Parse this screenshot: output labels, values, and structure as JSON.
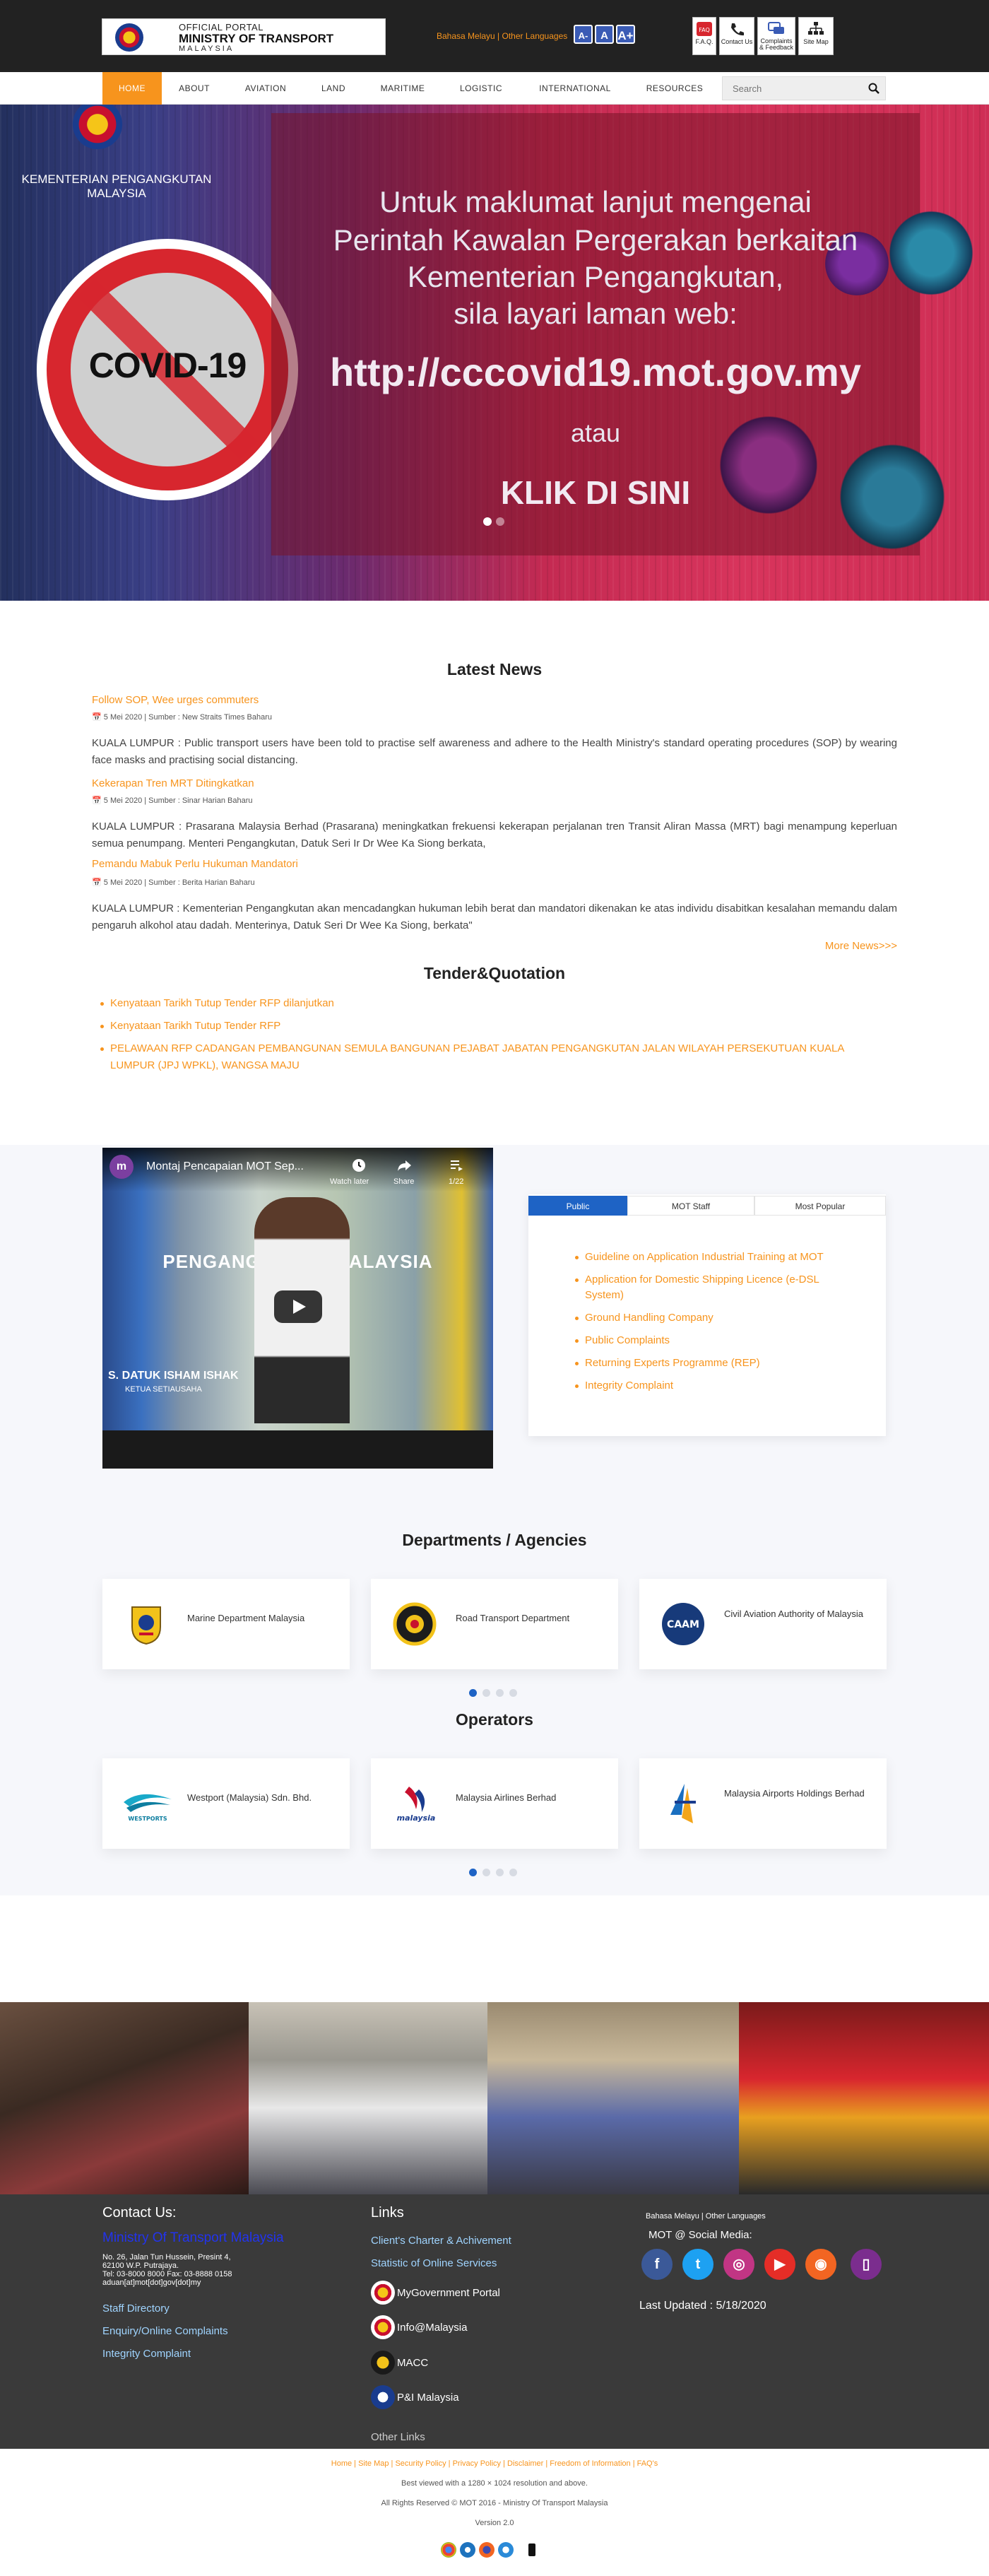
{
  "header": {
    "logo_line1": "OFFICIAL PORTAL",
    "logo_line2": "MINISTRY OF TRANSPORT",
    "logo_line3": "MALAYSIA",
    "lang_bm": "Bahasa Melayu",
    "lang_sep": " | ",
    "lang_other": "Other Languages",
    "font_buttons": [
      "A-",
      "A",
      "A+"
    ],
    "top_icons": [
      {
        "label": "F.A.Q.",
        "icon": "faq-icon"
      },
      {
        "label": "Contact Us",
        "icon": "contact-icon"
      },
      {
        "label": "Complaints & Feedback",
        "icon": "feedback-icon"
      },
      {
        "label": "Site Map",
        "icon": "sitemap-icon"
      }
    ]
  },
  "nav": {
    "items": [
      "HOME",
      "ABOUT",
      "AVIATION",
      "LAND",
      "MARITIME",
      "LOGISTIC",
      "INTERNATIONAL",
      "RESOURCES"
    ],
    "search_placeholder": "Search"
  },
  "hero": {
    "ministry": "KEMENTERIAN PENGANGKUTAN MALAYSIA",
    "covid": "COVID-19",
    "line1": "Untuk maklumat lanjut mengenai",
    "line2": "Perintah Kawalan Pergerakan berkaitan",
    "line3": "Kementerian Pengangkutan,",
    "line4": "sila layari laman web:",
    "url": "http://cccovid19.mot.gov.my",
    "atau": "atau",
    "klik": "KLIK DI SINI",
    "active_slide": 1,
    "slide_count": 2
  },
  "news": {
    "title": "Latest News",
    "items": [
      {
        "headline": "Follow SOP, Wee urges commuters",
        "meta": "5 Mei 2020 | Sumber : New Straits Times Baharu",
        "body": "KUALA LUMPUR : Public transport users have been told to practise self awareness and adhere to the Health Ministry's standard operating procedures (SOP) by wearing face masks and practising social distancing."
      },
      {
        "headline": "Kekerapan Tren MRT Ditingkatkan",
        "meta": "5 Mei 2020 | Sumber : Sinar Harian Baharu",
        "body": "KUALA LUMPUR : Prasarana Malaysia Berhad (Prasarana) meningkatkan frekuensi kekerapan perjalanan tren Transit Aliran Massa (MRT) bagi menampung keperluan semua penumpang. Menteri Pengangkutan, Datuk Seri Ir Dr Wee Ka Siong berkata,"
      },
      {
        "headline": "Pemandu Mabuk Perlu Hukuman Mandatori",
        "meta": "5 Mei 2020 | Sumber : Berita Harian Baharu",
        "body": "KUALA LUMPUR : Kementerian Pengangkutan akan mencadangkan hukuman lebih berat dan mandatori dikenakan ke atas individu disabitkan kesalahan memandu dalam pengaruh alkohol atau dadah. Menterinya, Datuk Seri Dr Wee Ka Siong, berkata\""
      }
    ],
    "more": "More News>>>"
  },
  "tender": {
    "title": "Tender&Quotation",
    "items": [
      "Kenyataan Tarikh Tutup Tender RFP dilanjutkan",
      "Kenyataan Tarikh Tutup Tender RFP",
      "PELAWAAN RFP CADANGAN PEMBANGUNAN SEMULA BANGUNAN PEJABAT JABATAN PENGANGKUTAN JALAN WILAYAH PERSEKUTUAN KUALA LUMPUR (JPJ WPKL), WANGSA MAJU"
    ]
  },
  "video": {
    "avatar": "m",
    "title": "Montaj Pencapaian MOT Sep...",
    "watch_later": "Watch later",
    "share": "Share",
    "counter": "1/22",
    "mot_text": "PENGANGKUTAN MALAYSIA",
    "caption1": "S. DATUK ISHAM ISHAK",
    "caption2": "KETUA SETIAUSAHA"
  },
  "quick_links": {
    "tabs": [
      "Public",
      "MOT Staff",
      "Most Popular"
    ],
    "items": [
      "Guideline on Application Industrial Training at MOT",
      "Application for Domestic Shipping Licence (e-DSL System)",
      "Ground Handling Company",
      "Public Complaints",
      "Returning Experts Programme (REP)",
      "Integrity Complaint"
    ]
  },
  "departments": {
    "title": "Departments / Agencies",
    "items": [
      "Marine Department Malaysia",
      "Road Transport Department",
      "Civil Aviation Authority of Malaysia"
    ],
    "logo_text": [
      "",
      "",
      "CAAM"
    ],
    "active_page": 1,
    "page_count": 4
  },
  "operators": {
    "title": "Operators",
    "items": [
      "Westport (Malaysia) Sdn. Bhd.",
      "Malaysia Airlines Berhad",
      "Malaysia Airports Holdings Berhad"
    ],
    "logo_text": [
      "WESTPORTS",
      "malaysia",
      ""
    ],
    "active_page": 1,
    "page_count": 4
  },
  "footer": {
    "contact_title": "Contact Us:",
    "ministry": "Ministry Of Transport Malaysia",
    "address1": "No. 26, Jalan Tun Hussein, Presint 4,",
    "address2": "62100 W.P. Putrajaya.",
    "phone": "Tel: 03-8000 8000 Fax: 03-8888 0158",
    "email": "aduan[at]mot[dot]gov[dot]my",
    "staff_directory": "Staff Directory",
    "enquiry": "Enquiry/Online Complaints",
    "integrity": "Integrity Complaint",
    "links_title": "Links",
    "clients_charter": "Client's Charter & Achivement",
    "statistic": "Statistic of Online Services",
    "portals": [
      "MyGovernment Portal",
      "Info@Malaysia",
      "MACC",
      "P&I Malaysia"
    ],
    "other_links": "Other Links",
    "lang_line": "Bahasa Melayu | Other Languages",
    "social_title": "MOT @ Social Media:",
    "social": [
      {
        "name": "facebook",
        "glyph": "f",
        "color": "#3b5998"
      },
      {
        "name": "twitter",
        "glyph": "t",
        "color": "#1da1f2"
      },
      {
        "name": "instagram",
        "glyph": "◎",
        "color": "#c13584"
      },
      {
        "name": "youtube",
        "glyph": "▶",
        "color": "#e52d27"
      },
      {
        "name": "rss",
        "glyph": "◉",
        "color": "#f26522"
      },
      {
        "name": "mobile",
        "glyph": "▯",
        "color": "#7b2d8e"
      }
    ],
    "last_updated": "Last Updated : 5/18/2020"
  },
  "bottom": {
    "links": "Home | Site Map | Security Policy | Privacy Policy | Disclaimer | Freedom of Information | FAQ's",
    "best_viewed": "Best viewed with a 1280 × 1024 resolution and above.",
    "rights": "All Rights Reserved © MOT 2016 - Ministry Of Transport Malaysia",
    "version": "Version 2.0"
  },
  "colors": {
    "accent": "#f7941d",
    "primary": "#1e63c5",
    "dark": "#222222",
    "footer": "#3a3a3a",
    "link": "#9fd4ff"
  }
}
